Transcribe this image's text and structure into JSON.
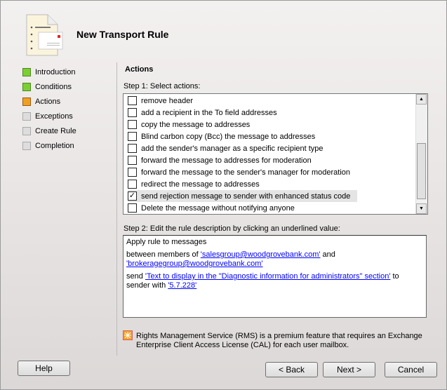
{
  "title": "New Transport Rule",
  "nav": [
    {
      "label": "Introduction",
      "state": "done"
    },
    {
      "label": "Conditions",
      "state": "done"
    },
    {
      "label": "Actions",
      "state": "current"
    },
    {
      "label": "Exceptions",
      "state": "pending"
    },
    {
      "label": "Create Rule",
      "state": "pending"
    },
    {
      "label": "Completion",
      "state": "pending"
    }
  ],
  "section": "Actions",
  "step1": "Step 1: Select actions:",
  "actions": [
    {
      "label": "remove header",
      "checked": false
    },
    {
      "label": "add a recipient in the To field addresses",
      "checked": false
    },
    {
      "label": "copy the message to addresses",
      "checked": false
    },
    {
      "label": "Blind carbon copy (Bcc) the message to addresses",
      "checked": false
    },
    {
      "label": "add the sender's manager as a specific recipient type",
      "checked": false
    },
    {
      "label": "forward the message to addresses for moderation",
      "checked": false
    },
    {
      "label": "forward the message to the sender's manager for moderation",
      "checked": false
    },
    {
      "label": "redirect the message to addresses",
      "checked": false
    },
    {
      "label": "send rejection message to sender with enhanced status code",
      "checked": true
    },
    {
      "label": "Delete the message without notifying anyone",
      "checked": false
    }
  ],
  "step2": "Step 2: Edit the rule description by clicking an underlined value:",
  "desc": {
    "line1": "Apply rule to messages",
    "between": "between members of ",
    "group1": "'salesgroup@woodgrovebank.com'",
    "and": " and ",
    "group2": "'brokeragegroup@woodgrovebank.com'",
    "send": "send ",
    "text_link": "'Text to display in the \"Diagnostic information for administrators\" section'",
    "to_sender": " to sender with ",
    "code": "'5.7.228'"
  },
  "rms_note": "Rights Management Service (RMS) is a premium feature that requires an Exchange Enterprise Client Access License (CAL) for each user mailbox.",
  "buttons": {
    "help": "Help",
    "back": "< Back",
    "next": "Next >",
    "cancel": "Cancel"
  }
}
